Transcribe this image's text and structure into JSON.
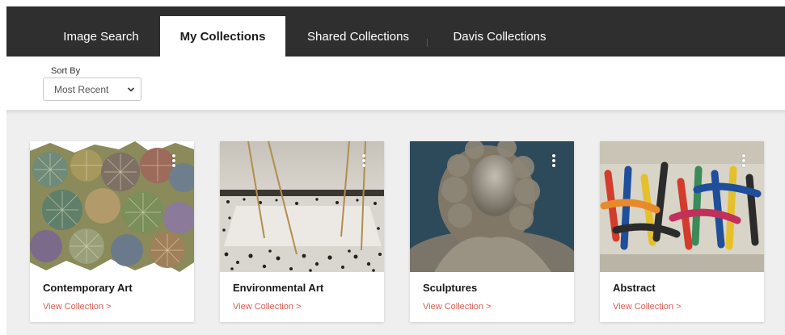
{
  "nav": {
    "tabs": [
      {
        "label": "Image Search",
        "active": false
      },
      {
        "label": "My Collections",
        "active": true
      },
      {
        "label": "Shared Collections",
        "active": false
      },
      {
        "label": "Davis Collections",
        "active": false
      }
    ]
  },
  "sort": {
    "label": "Sort By",
    "selected": "Most Recent",
    "icon": "chevron-down-icon"
  },
  "collections": [
    {
      "title": "Contemporary Art",
      "link": "View Collection >"
    },
    {
      "title": "Environmental Art",
      "link": "View Collection >"
    },
    {
      "title": "Sculptures",
      "link": "View Collection >"
    },
    {
      "title": "Abstract",
      "link": "View Collection >"
    }
  ],
  "colors": {
    "nav_bg": "#2f2f2f",
    "link": "#e05a4e",
    "grid_bg": "#efefef"
  }
}
